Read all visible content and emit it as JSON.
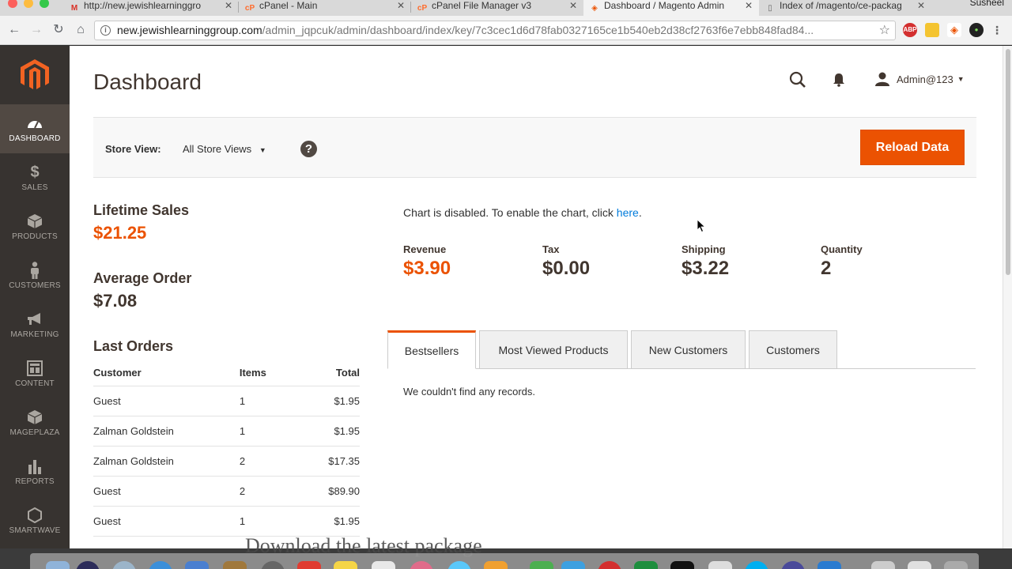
{
  "browser": {
    "tabs": [
      {
        "title": "http://new.jewishlearninggro",
        "favicon": "gmail-icon",
        "color": "#d93025"
      },
      {
        "title": "cPanel - Main",
        "favicon": "cpanel-icon",
        "color": "#ff6c2c"
      },
      {
        "title": "cPanel File Manager v3",
        "favicon": "cpanel-icon",
        "color": "#ff6c2c"
      },
      {
        "title": "Dashboard / Magento Admin",
        "favicon": "magento-icon",
        "color": "#eb5202",
        "active": true
      },
      {
        "title": "Index of /magento/ce-packag",
        "favicon": "document-icon",
        "color": "#666666"
      }
    ],
    "profile": "Susheel",
    "url_host": "new.jewishlearninggroup.com",
    "url_path": "/admin_jqpcuk/admin/dashboard/index/key/7c3cec1d6d78fab0327165ce1b540eb2d38cf2763f6e7ebb848fad84..."
  },
  "sidebar": {
    "items": [
      {
        "label": "DASHBOARD",
        "icon": "dashboard-icon",
        "active": true
      },
      {
        "label": "SALES",
        "icon": "dollar-icon"
      },
      {
        "label": "PRODUCTS",
        "icon": "cube-icon"
      },
      {
        "label": "CUSTOMERS",
        "icon": "person-icon"
      },
      {
        "label": "MARKETING",
        "icon": "megaphone-icon"
      },
      {
        "label": "CONTENT",
        "icon": "layout-icon"
      },
      {
        "label": "MAGEPLAZA",
        "icon": "cube-icon"
      },
      {
        "label": "REPORTS",
        "icon": "bar-chart-icon"
      },
      {
        "label": "SMARTWAVE",
        "icon": "hexagon-icon"
      }
    ]
  },
  "header": {
    "title": "Dashboard",
    "user": "Admin@123"
  },
  "store": {
    "label": "Store View:",
    "value": "All Store Views",
    "reload_label": "Reload Data"
  },
  "stats": {
    "lifetime_label": "Lifetime Sales",
    "lifetime_value": "$21.25",
    "average_label": "Average Order",
    "average_value": "$7.08"
  },
  "orders": {
    "title": "Last Orders",
    "headers": {
      "customer": "Customer",
      "items": "Items",
      "total": "Total"
    },
    "rows": [
      {
        "customer": "Guest",
        "items": "1",
        "total": "$1.95"
      },
      {
        "customer": "Zalman Goldstein",
        "items": "1",
        "total": "$1.95"
      },
      {
        "customer": "Zalman Goldstein",
        "items": "2",
        "total": "$17.35"
      },
      {
        "customer": "Guest",
        "items": "2",
        "total": "$89.90"
      },
      {
        "customer": "Guest",
        "items": "1",
        "total": "$1.95"
      }
    ]
  },
  "chart": {
    "message": "Chart is disabled. To enable the chart, click ",
    "link": "here",
    "period": "."
  },
  "totals": [
    {
      "label": "Revenue",
      "value": "$3.90",
      "accent": true
    },
    {
      "label": "Tax",
      "value": "$0.00"
    },
    {
      "label": "Shipping",
      "value": "$3.22"
    },
    {
      "label": "Quantity",
      "value": "2"
    }
  ],
  "tabs": [
    {
      "label": "Bestsellers",
      "active": true
    },
    {
      "label": "Most Viewed Products"
    },
    {
      "label": "New Customers"
    },
    {
      "label": "Customers"
    }
  ],
  "tab_content": "We couldn't find any records.",
  "overlay_text": "Download the latest package",
  "colors": {
    "accent": "#eb5202",
    "sidebar": "#373330",
    "link": "#007bdb"
  }
}
